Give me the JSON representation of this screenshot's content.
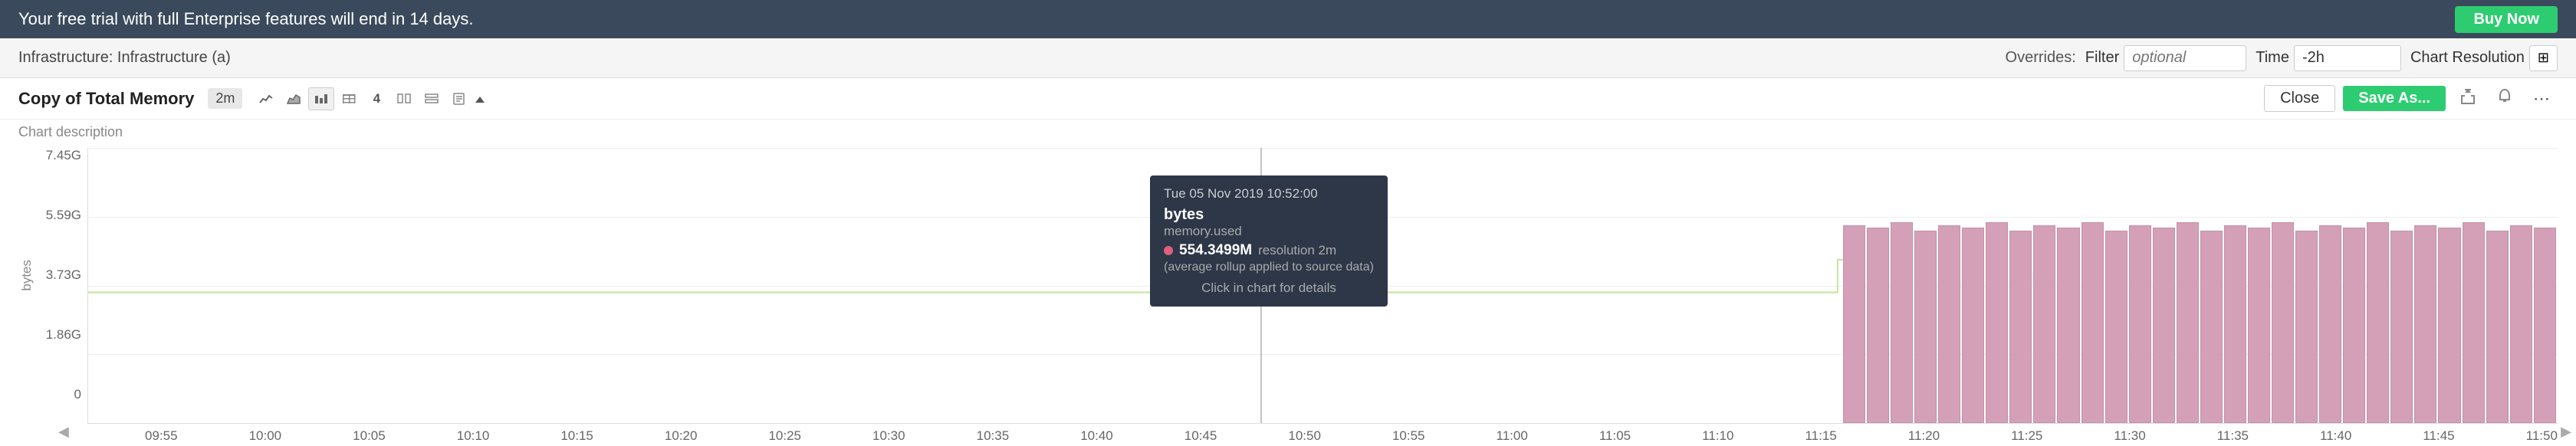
{
  "banner": {
    "text": "Your free trial with full Enterprise features will end in 14 days.",
    "buy_button": "Buy Now"
  },
  "topbar": {
    "breadcrumb": "Infrastructure: Infrastructure (a)",
    "overrides_label": "Overrides:",
    "filter_label": "Filter",
    "filter_placeholder": "optional",
    "time_label": "Time",
    "time_value": "-2h",
    "chart_resolution_label": "Chart Resolution",
    "resolution_icon": "⊞"
  },
  "chart_toolbar": {
    "title": "Copy of Total Memory",
    "time_badge": "2m",
    "icons": [
      {
        "name": "line-chart-icon",
        "symbol": "📈",
        "unicode": "〜"
      },
      {
        "name": "bar-chart-icon",
        "symbol": "▦",
        "unicode": "▦"
      },
      {
        "name": "area-chart-icon",
        "symbol": "▩",
        "unicode": "▩"
      },
      {
        "name": "table-icon",
        "symbol": "≡",
        "unicode": "≡"
      },
      {
        "name": "number-4-icon",
        "symbol": "4",
        "unicode": "4"
      },
      {
        "name": "split-icon",
        "symbol": "⊞",
        "unicode": "⊞"
      },
      {
        "name": "stack-icon",
        "symbol": "⊟",
        "unicode": "⊟"
      },
      {
        "name": "note-icon",
        "symbol": "📋",
        "unicode": "🗒"
      }
    ],
    "close_label": "Close",
    "save_label": "Save As...",
    "share_icon": "↑",
    "bell_icon": "🔔",
    "more_icon": "⋯"
  },
  "chart": {
    "description": "Chart description",
    "y_axis_label": "bytes",
    "y_ticks": [
      "7.45G",
      "5.59G",
      "3.73G",
      "1.86G",
      "0"
    ],
    "x_ticks": [
      "09:55",
      "10:00",
      "10:05",
      "10:10",
      "10:15",
      "10:20",
      "10:25",
      "10:30",
      "10:35",
      "10:40",
      "10:45",
      "10:50",
      "10:55",
      "11:00",
      "11:05",
      "11:10",
      "11:15",
      "11:20",
      "11:25",
      "11:30",
      "11:35",
      "11:40",
      "11:45",
      "11:50"
    ]
  },
  "tooltip": {
    "date": "Tue 05 Nov 2019 10:52:00",
    "metric": "bytes",
    "sub_metric": "memory.used",
    "value": "554.3499M",
    "resolution": "resolution 2m",
    "avg_note": "(average rollup applied to source data)",
    "click_note": "Click in chart for details"
  }
}
